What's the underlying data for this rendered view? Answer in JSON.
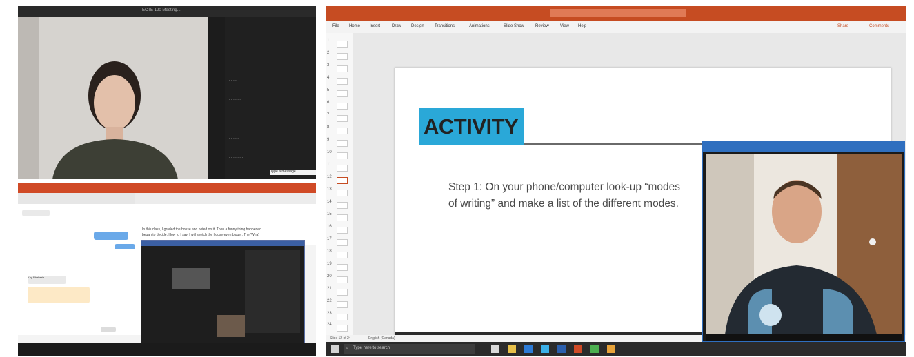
{
  "panel1": {
    "window_title": "ECTE 120 Meeting...",
    "sidebar_caption": "Type a message..."
  },
  "panel2": {
    "chat_sender": "Kay Rheberie",
    "doc_line1": "In this class, I graded the house and noted on it. Then a funny thing happened",
    "doc_line2": "began to decide. How to I say. I will sketch the house even bigger. The 'Wha'"
  },
  "panel3": {
    "ribbon_tabs": [
      "File",
      "Home",
      "Insert",
      "Draw",
      "Design",
      "Transitions",
      "Animations",
      "Slide Show",
      "Review",
      "View",
      "Help"
    ],
    "share_label": "Share",
    "comments_label": "Comments",
    "slide_numbers": [
      "1",
      "2",
      "3",
      "4",
      "5",
      "6",
      "7",
      "8",
      "9",
      "10",
      "11",
      "12",
      "13",
      "14",
      "15",
      "16",
      "17",
      "18",
      "19",
      "20",
      "21",
      "22",
      "23",
      "24"
    ],
    "slide": {
      "heading": "ACTIVITY",
      "body_line1": "Step 1: On your phone/computer look-up “modes",
      "body_line2": "of writing” and make a list of the different modes."
    },
    "taskbar_search": "Type here to search",
    "status_slide": "Slide 12 of 24",
    "status_lang": "English (Canada)"
  },
  "colors": {
    "office_orange": "#c64c22",
    "activity_blue": "#2aa8d8",
    "zoom_blue": "#2f6fbf"
  }
}
